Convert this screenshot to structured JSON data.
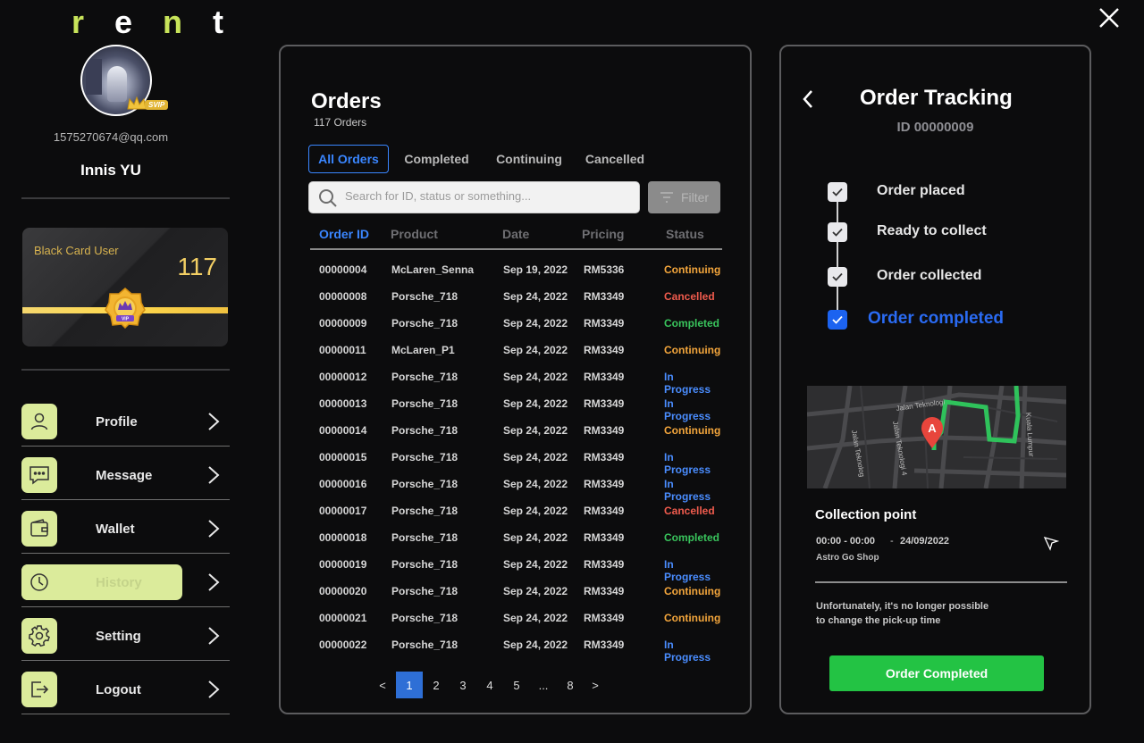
{
  "logo": {
    "letters": [
      "r",
      "e",
      "n",
      "t"
    ]
  },
  "profile": {
    "badge": "SVIP",
    "email": "1575270674@qq.com",
    "name": "Innis YU"
  },
  "card": {
    "title": "Black Card User",
    "number": "117",
    "badge_text": "VIP"
  },
  "menu": [
    {
      "label": "Profile",
      "icon": "user-icon"
    },
    {
      "label": "Message",
      "icon": "message-icon"
    },
    {
      "label": "Wallet",
      "icon": "wallet-icon"
    },
    {
      "label": "History",
      "icon": "clock-icon",
      "active": true
    },
    {
      "label": "Setting",
      "icon": "gear-icon"
    },
    {
      "label": "Logout",
      "icon": "logout-icon"
    }
  ],
  "orders": {
    "title": "Orders",
    "count": "117 Orders",
    "tabs": [
      "All Orders",
      "Completed",
      "Continuing",
      "Cancelled"
    ],
    "active_tab": "All Orders",
    "search_placeholder": "Search for ID, status or something...",
    "filter_label": "Filter",
    "columns": [
      "Order ID",
      "Product",
      "Date",
      "Pricing",
      "Status"
    ],
    "rows": [
      [
        "00000004",
        "McLaren_Senna",
        "Sep 19, 2022",
        "RM5336",
        "Continuing"
      ],
      [
        "00000008",
        "Porsche_718",
        "Sep 24, 2022",
        "RM3349",
        "Cancelled"
      ],
      [
        "00000009",
        "Porsche_718",
        "Sep 24, 2022",
        "RM3349",
        "Completed"
      ],
      [
        "00000011",
        "McLaren_P1",
        "Sep 24, 2022",
        "RM3349",
        "Continuing"
      ],
      [
        "00000012",
        "Porsche_718",
        "Sep 24, 2022",
        "RM3349",
        "In Progress"
      ],
      [
        "00000013",
        "Porsche_718",
        "Sep 24, 2022",
        "RM3349",
        "In Progress"
      ],
      [
        "00000014",
        "Porsche_718",
        "Sep 24, 2022",
        "RM3349",
        "Continuing"
      ],
      [
        "00000015",
        "Porsche_718",
        "Sep 24, 2022",
        "RM3349",
        "In Progress"
      ],
      [
        "00000016",
        "Porsche_718",
        "Sep 24, 2022",
        "RM3349",
        "In Progress"
      ],
      [
        "00000017",
        "Porsche_718",
        "Sep 24, 2022",
        "RM3349",
        "Cancelled"
      ],
      [
        "00000018",
        "Porsche_718",
        "Sep 24, 2022",
        "RM3349",
        "Completed"
      ],
      [
        "00000019",
        "Porsche_718",
        "Sep 24, 2022",
        "RM3349",
        "In Progress"
      ],
      [
        "00000020",
        "Porsche_718",
        "Sep 24, 2022",
        "RM3349",
        "Continuing"
      ],
      [
        "00000021",
        "Porsche_718",
        "Sep 24, 2022",
        "RM3349",
        "Continuing"
      ],
      [
        "00000022",
        "Porsche_718",
        "Sep 24, 2022",
        "RM3349",
        "In Progress"
      ]
    ],
    "pagination": [
      "<",
      "1",
      "2",
      "3",
      "4",
      "5",
      "...",
      "8",
      ">"
    ],
    "current_page": "1"
  },
  "tracking": {
    "title": "Order Tracking",
    "id": "ID 00000009",
    "steps": [
      "Order placed",
      "Ready to collect",
      "Order collected",
      "Order completed"
    ],
    "map": {
      "marker": "A",
      "streets": [
        "Jalan Teknologi",
        "Jalan Teknologi 4",
        "Jalan Teknolog",
        "Kuala Lumpur"
      ]
    },
    "collection_title": "Collection point",
    "time": "00:00 - 00:00",
    "separator": "-",
    "date": "24/09/2022",
    "shop": "Astro Go Shop",
    "note_line1": "Unfortunately, it's no longer possible",
    "note_line2": "to change the pick-up time",
    "button": "Order Completed"
  },
  "colors": {
    "accent_green": "#c8e45a",
    "menu_icon_bg": "#dbeb9b",
    "primary_blue": "#3a86ff",
    "completed": "#39c45c",
    "continuing": "#f4a63c",
    "cancelled": "#ef5b4d",
    "in_progress": "#4a8dff",
    "button_green": "#23c344"
  }
}
